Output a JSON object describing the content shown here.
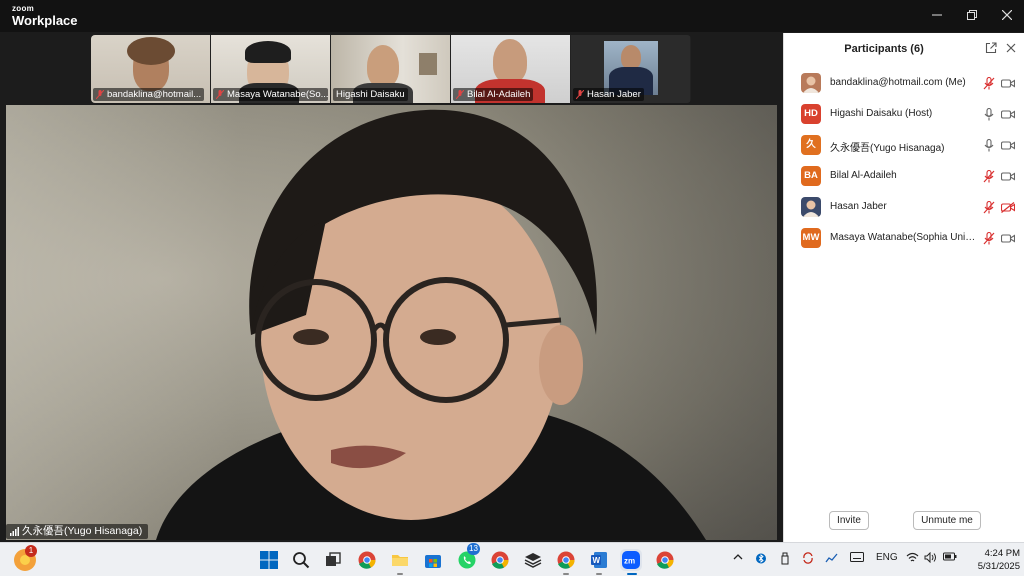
{
  "window": {
    "brand_small": "zoom",
    "brand_big": "Workplace"
  },
  "thumbnails": [
    {
      "label": "bandaklina@hotmail...",
      "muted": true
    },
    {
      "label": "Masaya Watanabe(So...",
      "muted": true
    },
    {
      "label": "Higashi Daisaku",
      "muted": false
    },
    {
      "label": "Bilal Al-Adaileh",
      "muted": true
    },
    {
      "label": "Hasan Jaber",
      "muted": true
    }
  ],
  "main_video": {
    "speaker_name": "久永優吾(Yugo Hisanaga)"
  },
  "participants_panel": {
    "title": "Participants (6)",
    "participants": [
      {
        "name": "bandaklina@hotmail.com (Me)",
        "avatar": "",
        "avatar_color": "#b87a5a",
        "mic": "muted",
        "cam": "on"
      },
      {
        "name": "Higashi Daisaku (Host)",
        "avatar": "HD",
        "avatar_color": "#d9412e",
        "mic": "on",
        "cam": "on"
      },
      {
        "name": "久永優吾(Yugo Hisanaga)",
        "avatar": "久",
        "avatar_color": "#e07020",
        "mic": "on",
        "cam": "on"
      },
      {
        "name": "Bilal Al-Adaileh",
        "avatar": "BA",
        "avatar_color": "#e06a1e",
        "mic": "muted",
        "cam": "on"
      },
      {
        "name": "Hasan Jaber",
        "avatar": "",
        "avatar_color": "#3b4a6b",
        "mic": "muted",
        "cam": "off"
      },
      {
        "name": "Masaya Watanabe(Sophia Unive...",
        "avatar": "MW",
        "avatar_color": "#e06a1e",
        "mic": "muted",
        "cam": "on"
      }
    ],
    "invite_label": "Invite",
    "unmute_label": "Unmute me"
  },
  "taskbar": {
    "notification_badge": "1",
    "whatsapp_badge": "13",
    "language": "ENG",
    "time": "4:24 PM",
    "date": "5/31/2025"
  },
  "colors": {
    "muted_red": "#d93030",
    "windows_blue": "#0067c0",
    "zoom_blue": "#0b5cff"
  }
}
